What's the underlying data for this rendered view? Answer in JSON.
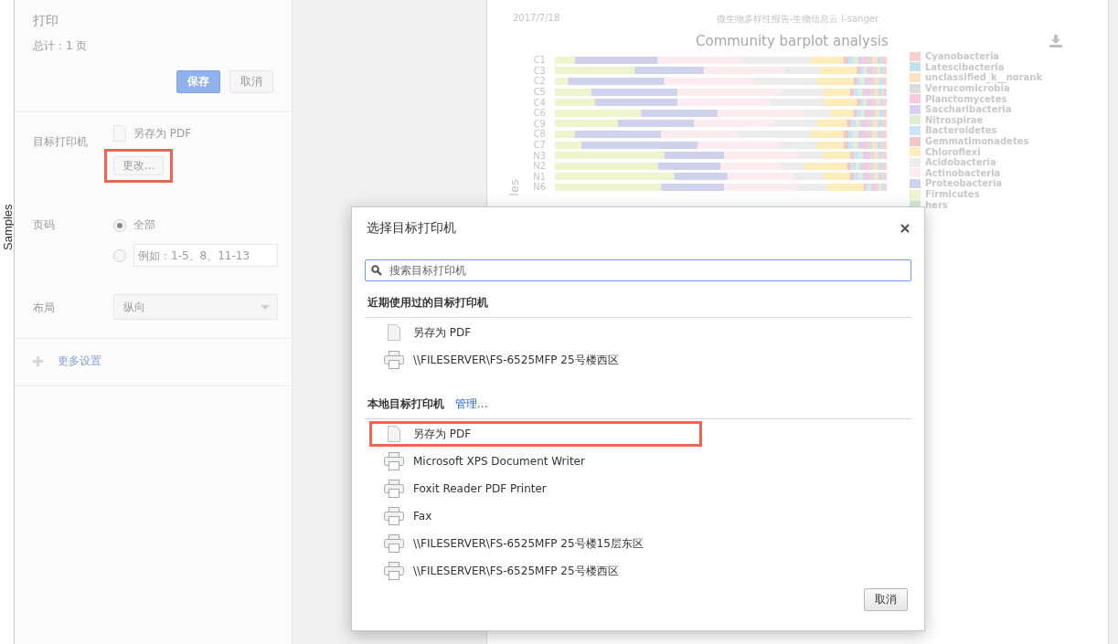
{
  "edge_label": "Samples",
  "sidebar": {
    "title": "打印",
    "summary": "总计：1 页",
    "buttons": [
      {
        "label": "保存",
        "kind": "primary"
      },
      {
        "label": "取消",
        "kind": "secondary"
      }
    ],
    "destination": {
      "label": "目标打印机",
      "value": "另存为 PDF",
      "change_button": {
        "label": "更改...",
        "highlighted": true
      }
    },
    "pages": {
      "label": "页码",
      "options": [
        {
          "kind": "text",
          "label": "全部",
          "selected": true
        },
        {
          "kind": "input",
          "placeholder": "例如：1-5、8、11-13",
          "selected": false
        }
      ]
    },
    "layout": {
      "label": "布局",
      "value": "纵向"
    },
    "more_settings": "更多设置"
  },
  "preview": {
    "date": "2017/7/18",
    "header": "微生物多样性报告-生物信息云 i-sanger",
    "chart_title": "Community barplot analysis",
    "axis_label": "les",
    "rows": [
      "C1",
      "C3",
      "C2",
      "C5",
      "C4",
      "C6",
      "C9",
      "C8",
      "C7",
      "N3",
      "N2",
      "N1",
      "N6"
    ],
    "legend": [
      {
        "label": "Cyanobacteria",
        "color": "#fbd0d0"
      },
      {
        "label": "Latescibacteria",
        "color": "#c2e2f2"
      },
      {
        "label": "unclassified_k__norank",
        "color": "#fde2c2"
      },
      {
        "label": "Verrucomicrobia",
        "color": "#dcdcdc"
      },
      {
        "label": "Planctomycetes",
        "color": "#f8c8dc"
      },
      {
        "label": "Saccharibacteria",
        "color": "#dcd0ee"
      },
      {
        "label": "Nitrospirae",
        "color": "#e0eed4"
      },
      {
        "label": "Bacteroidetes",
        "color": "#c8e4f8"
      },
      {
        "label": "Gemmatimonadetes",
        "color": "#f0c8c8"
      },
      {
        "label": "Chloroflexi",
        "color": "#fdecbc"
      },
      {
        "label": "Acidobacteria",
        "color": "#ececec"
      },
      {
        "label": "Actinobacteria",
        "color": "#fcebef"
      },
      {
        "label": "Proteobacteria",
        "color": "#d0d2ec"
      },
      {
        "label": "Firmicutes",
        "color": "#eef4cc"
      },
      {
        "label": "hers",
        "color": "#d8ecd8"
      }
    ]
  },
  "dialog": {
    "title": "选择目标打印机",
    "search_placeholder": "搜索目标打印机",
    "sections": [
      {
        "title": "近期使用过的目标打印机",
        "items": [
          {
            "kind": "document",
            "label": "另存为 PDF",
            "highlighted": false
          },
          {
            "kind": "printer",
            "label": "\\\\FILESERVER\\FS-6525MFP 25号楼西区",
            "highlighted": false
          }
        ]
      },
      {
        "title": "本地目标打印机",
        "link": "管理...",
        "items": [
          {
            "kind": "document",
            "label": "另存为 PDF",
            "highlighted": true
          },
          {
            "kind": "printer",
            "label": "Microsoft XPS Document Writer",
            "highlighted": false
          },
          {
            "kind": "printer",
            "label": "Foxit Reader PDF Printer",
            "highlighted": false
          },
          {
            "kind": "printer",
            "label": "Fax",
            "highlighted": false
          },
          {
            "kind": "printer",
            "label": "\\\\FILESERVER\\FS-6525MFP 25号楼15层东区",
            "highlighted": false
          },
          {
            "kind": "printer",
            "label": "\\\\FILESERVER\\FS-6525MFP 25号楼西区",
            "highlighted": false
          }
        ]
      }
    ],
    "cancel": "取消"
  }
}
